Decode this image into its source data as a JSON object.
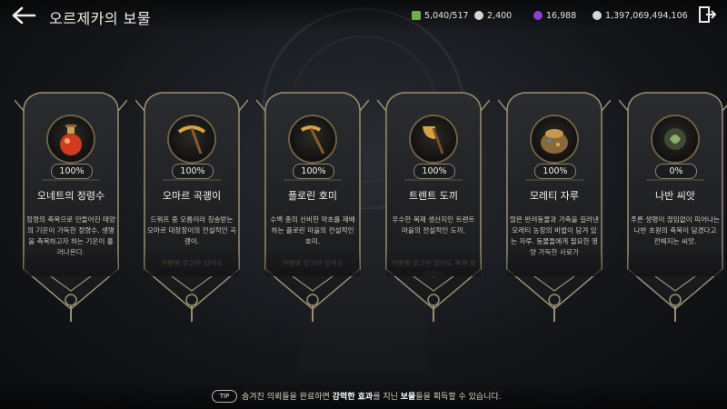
{
  "header": {
    "title": "오르제카의 보물"
  },
  "resources": [
    {
      "name": "stamina",
      "icon": "leaf-icon",
      "color": "#6fae4a",
      "value": "5,040/517"
    },
    {
      "name": "pearl",
      "icon": "pearl-icon",
      "color": "#d9d2cf",
      "value": "2,400"
    },
    {
      "name": "gem",
      "icon": "purple-gem-icon",
      "color": "#8a3fd8",
      "value": "16,988"
    },
    {
      "name": "silver",
      "icon": "silver-coin-icon",
      "color": "#cfd6df",
      "value": "1,397,069,494,106"
    }
  ],
  "cards": [
    {
      "percent": "100%",
      "name": "오네트의 정령수",
      "desc": "정령의 축복으로 만들어진 태양의 기운이 가득한 정령수. 생명을 축복하고자 하는 기운이 흘러나온다.",
      "icon": "potion-icon"
    },
    {
      "percent": "100%",
      "name": "오마르 곡괭이",
      "desc": "드워프 중 오름이라 칭송받는 오마르 대장장이의 전설적인 곡괭이.",
      "extra_hl": "가방",
      "extra": "에 갖고만 있어도",
      "icon": "pickaxe-icon"
    },
    {
      "percent": "100%",
      "name": "플로린 호미",
      "desc": "수백 종의 신비한 약초를 재배하는 플로린 마을의 전설적인 호미.",
      "extra_hl": "가방",
      "extra": "에 갖고만 있어도",
      "icon": "hoe-icon"
    },
    {
      "percent": "100%",
      "name": "트렌트 도끼",
      "desc": "우수한 목재 생산지인 트렌트 마을의 전설적인 도끼.",
      "extra_hl": "가방",
      "extra": "에 갖고만 있어도 목재 획득량이",
      "icon": "axe-icon"
    },
    {
      "percent": "100%",
      "name": "모레티 자루",
      "desc": "많은 반려동물과 가축을 길러낸 모레티 농장의 비법이 담겨 있는 자루. 동물들에게 필요한 영양 가득한 사료가",
      "icon": "sack-icon"
    },
    {
      "percent": "0%",
      "name": "나반 씨앗",
      "desc": "푸른 생명이 끊임없이 피어나는 나반 초원의 축복이 담겼다고 전해지는 씨앗.",
      "icon": "seed-icon"
    }
  ],
  "tip": {
    "badge": "TIP",
    "t1": "숨겨진 의뢰들을 완료하면 ",
    "b1": "강력한 효과",
    "t2": "를 지닌 ",
    "b2": "보물",
    "t3": "들을 획득할 수 있습니다."
  }
}
